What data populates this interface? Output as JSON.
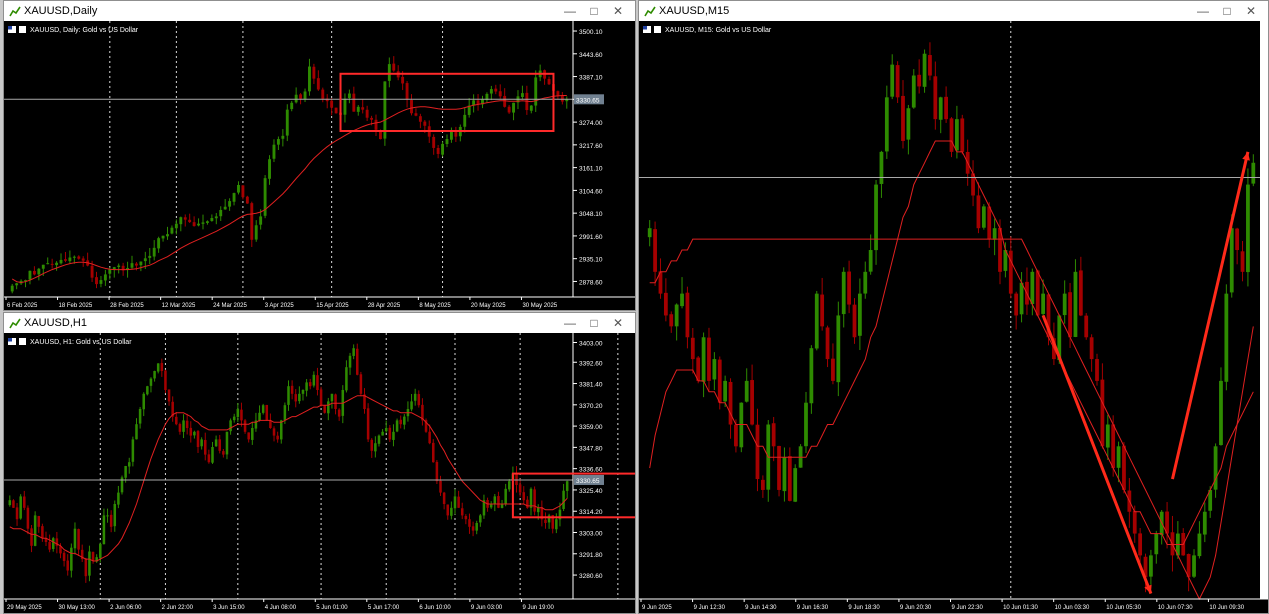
{
  "colors": {
    "bg": "#000000",
    "grid": "#ffffff",
    "axis": "#ffffff",
    "text": "#ffffff",
    "bull": "#2e8b00",
    "bear": "#a50000",
    "ma": "#e02020",
    "box": "#ff2a2a",
    "arrow": "#ff2a1a",
    "priceLine": "#a9a9a9",
    "priceTagBg": "#708090"
  },
  "windows": [
    {
      "id": "daily",
      "title": "XAUUSD,Daily",
      "icon": "chart-window-icon"
    },
    {
      "id": "h1",
      "title": "XAUUSD,H1",
      "icon": "chart-window-icon"
    },
    {
      "id": "m15",
      "title": "XAUUSD,M15",
      "icon": "chart-window-icon"
    }
  ],
  "chart_data": [
    {
      "type": "candlestick",
      "id": "daily",
      "symbol_line": "XAUUSD, Daily:  Gold vs US Dollar",
      "ylim": [
        2840,
        3525
      ],
      "yticks": [
        "3500.10",
        "3443.60",
        "3387.10",
        "3330.60",
        "3274.00",
        "3217.60",
        "3161.10",
        "3104.60",
        "3048.10",
        "2991.60",
        "2935.10",
        "2878.60"
      ],
      "xticks": [
        "6 Feb 2025",
        "18 Feb 2025",
        "28 Feb 2025",
        "12 Mar 2025",
        "24 Mar 2025",
        "3 Apr 2025",
        "15 Apr 2025",
        "28 Apr 2025",
        "8 May 2025",
        "20 May 2025",
        "30 May 2025"
      ],
      "current_price": "3330.65",
      "current_price_value": 3330.65,
      "vlines_at_candles": [
        22,
        37,
        52,
        72,
        97
      ],
      "closes": [
        2868,
        2874,
        2880,
        2882,
        2905,
        2896,
        2910,
        2920,
        2924,
        2920,
        2925,
        2932,
        2930,
        2938,
        2940,
        2935,
        2930,
        2918,
        2888,
        2872,
        2882,
        2896,
        2908,
        2914,
        2918,
        2906,
        2912,
        2924,
        2918,
        2928,
        2936,
        2942,
        2962,
        2986,
        2992,
        2996,
        3012,
        3022,
        3038,
        3032,
        3026,
        3016,
        3022,
        3025,
        3028,
        3036,
        3040,
        3056,
        3064,
        3078,
        3098,
        3118,
        3088,
        3072,
        2982,
        3018,
        3040,
        3135,
        3182,
        3218,
        3232,
        3240,
        3305,
        3322,
        3342,
        3332,
        3350,
        3412,
        3382,
        3355,
        3332,
        3326,
        3310,
        3296,
        3292,
        3332,
        3345,
        3300,
        3312,
        3305,
        3285,
        3280,
        3255,
        3232,
        3375,
        3418,
        3402,
        3385,
        3370,
        3330,
        3296,
        3290,
        3275,
        3265,
        3238,
        3210,
        3195,
        3220,
        3232,
        3250,
        3238,
        3262,
        3292,
        3315,
        3328,
        3318,
        3330,
        3344,
        3356,
        3350,
        3338,
        3312,
        3298,
        3322,
        3338,
        3346,
        3304,
        3315,
        3385,
        3402,
        3382,
        3368,
        3352,
        3340,
        3325,
        3330
      ],
      "ma": [
        2885,
        2878,
        2876,
        2878,
        2882,
        2887,
        2892,
        2898,
        2903,
        2908,
        2912,
        2916,
        2920,
        2923,
        2925,
        2926,
        2926,
        2925,
        2922,
        2918,
        2914,
        2911,
        2909,
        2908,
        2908,
        2908,
        2908,
        2909,
        2910,
        2913,
        2916,
        2919,
        2924,
        2930,
        2935,
        2940,
        2947,
        2954,
        2961,
        2967,
        2973,
        2978,
        2983,
        2988,
        2993,
        2998,
        3003,
        3009,
        3015,
        3021,
        3028,
        3035,
        3041,
        3045,
        3046,
        3048,
        3051,
        3057,
        3066,
        3076,
        3086,
        3096,
        3108,
        3121,
        3134,
        3146,
        3158,
        3172,
        3184,
        3194,
        3204,
        3213,
        3221,
        3228,
        3234,
        3241,
        3247,
        3253,
        3258,
        3263,
        3267,
        3270,
        3272,
        3274,
        3279,
        3285,
        3291,
        3297,
        3302,
        3306,
        3309,
        3311,
        3312,
        3312,
        3311,
        3309,
        3307,
        3306,
        3306,
        3306,
        3306,
        3307,
        3310,
        3313,
        3316,
        3318,
        3320,
        3322,
        3324,
        3326,
        3327,
        3327,
        3326,
        3326,
        3326,
        3327,
        3326,
        3325,
        3327,
        3331,
        3334,
        3336,
        3338,
        3339,
        3340,
        3340
      ],
      "box": {
        "t0": 74,
        "t1": 122,
        "high": 3394,
        "low": 3252
      }
    },
    {
      "type": "candlestick",
      "id": "h1",
      "symbol_line": "XAUUSD, H1:  Gold vs US Dollar",
      "ylim": [
        3268,
        3408
      ],
      "yticks": [
        "3403.00",
        "3392.60",
        "3381.40",
        "3370.20",
        "3359.00",
        "3347.80",
        "3336.60",
        "3325.40",
        "3314.20",
        "3303.00",
        "3291.80",
        "3280.60"
      ],
      "xticks": [
        "29 May 2025",
        "30 May 13:00",
        "2 Jun 06:00",
        "2 Jun 22:00",
        "3 Jun 15:00",
        "4 Jun 08:00",
        "5 Jun 01:00",
        "5 Jun 17:00",
        "6 Jun 10:00",
        "9 Jun 03:00",
        "9 Jun 19:00"
      ],
      "current_price": "3330.65",
      "current_price_value": 3330.65,
      "vlines_at_candles": [
        25,
        43,
        63,
        86,
        104,
        123,
        141,
        168,
        179
      ],
      "closes": [
        3320,
        3316,
        3310,
        3322,
        3316,
        3305,
        3296,
        3312,
        3306,
        3300,
        3298,
        3294,
        3300,
        3296,
        3292,
        3288,
        3283,
        3295,
        3305,
        3294,
        3289,
        3280,
        3293,
        3288,
        3290,
        3297,
        3312,
        3312,
        3306,
        3318,
        3324,
        3332,
        3338,
        3340,
        3352,
        3360,
        3368,
        3376,
        3380,
        3384,
        3388,
        3392,
        3388,
        3378,
        3372,
        3364,
        3360,
        3356,
        3362,
        3358,
        3354,
        3356,
        3348,
        3352,
        3344,
        3340,
        3348,
        3352,
        3346,
        3344,
        3356,
        3362,
        3364,
        3368,
        3362,
        3356,
        3352,
        3358,
        3362,
        3366,
        3370,
        3362,
        3358,
        3354,
        3352,
        3362,
        3370,
        3380,
        3376,
        3372,
        3376,
        3378,
        3382,
        3380,
        3386,
        3378,
        3370,
        3366,
        3372,
        3376,
        3368,
        3364,
        3378,
        3390,
        3396,
        3400,
        3386,
        3376,
        3368,
        3352,
        3346,
        3350,
        3354,
        3356,
        3358,
        3352,
        3356,
        3362,
        3360,
        3364,
        3368,
        3372,
        3376,
        3370,
        3362,
        3356,
        3350,
        3340,
        3330,
        3324,
        3318,
        3312,
        3316,
        3322,
        3316,
        3312,
        3310,
        3306,
        3304,
        3308,
        3312,
        3320,
        3316,
        3318,
        3322,
        3316,
        3318,
        3326,
        3330,
        3334,
        3328,
        3324,
        3320,
        3316,
        3326,
        3314,
        3316,
        3310,
        3308,
        3312,
        3305,
        3310,
        3315,
        3325,
        3330
      ],
      "ma": [
        3306,
        3305,
        3305,
        3305,
        3304,
        3303,
        3302,
        3302,
        3301,
        3300,
        3300,
        3299,
        3298,
        3297,
        3296,
        3294,
        3293,
        3292,
        3292,
        3291,
        3290,
        3289,
        3289,
        3288,
        3288,
        3289,
        3290,
        3291,
        3293,
        3295,
        3297,
        3300,
        3304,
        3308,
        3313,
        3318,
        3324,
        3330,
        3336,
        3342,
        3347,
        3352,
        3356,
        3360,
        3363,
        3365,
        3366,
        3366,
        3366,
        3365,
        3364,
        3362,
        3361,
        3359,
        3358,
        3357,
        3357,
        3357,
        3357,
        3357,
        3357,
        3358,
        3359,
        3360,
        3360,
        3360,
        3360,
        3361,
        3361,
        3362,
        3362,
        3362,
        3362,
        3361,
        3361,
        3361,
        3362,
        3363,
        3364,
        3364,
        3365,
        3366,
        3367,
        3368,
        3369,
        3369,
        3370,
        3370,
        3370,
        3371,
        3371,
        3371,
        3371,
        3372,
        3373,
        3374,
        3375,
        3375,
        3375,
        3374,
        3373,
        3372,
        3371,
        3370,
        3369,
        3368,
        3367,
        3367,
        3366,
        3366,
        3366,
        3366,
        3365,
        3364,
        3363,
        3361,
        3359,
        3356,
        3353,
        3349,
        3346,
        3342,
        3339,
        3336,
        3333,
        3330,
        3328,
        3326,
        3324,
        3322,
        3320,
        3319,
        3318,
        3318,
        3318,
        3318,
        3318,
        3318,
        3318,
        3318,
        3318,
        3318,
        3318,
        3317,
        3317,
        3317,
        3316,
        3316,
        3315,
        3315,
        3315,
        3316,
        3317,
        3319,
        3321
      ],
      "box": {
        "t0": 139,
        "t1": 179,
        "high": 3334,
        "low": 3311
      }
    },
    {
      "type": "candlestick",
      "id": "m15",
      "symbol_line": "XAUUSD, M15:  Gold vs US Dollar",
      "ylim": [
        3292,
        3345
      ],
      "yticks": [],
      "xticks": [
        "9 Jun 2025",
        "9 Jun 12:30",
        "9 Jun 14:30",
        "9 Jun 16:30",
        "9 Jun 18:30",
        "9 Jun 20:30",
        "9 Jun 22:30",
        "10 Jun 01:30",
        "10 Jun 03:30",
        "10 Jun 05:30",
        "10 Jun 07:30",
        "10 Jun 09:30"
      ],
      "current_price": "",
      "current_price_value": 3330.65,
      "vlines_at_candles": [
        67
      ],
      "closes": [
        3326,
        3322,
        3320,
        3318,
        3317,
        3319,
        3320,
        3316,
        3314,
        3312,
        3316,
        3312,
        3314,
        3310,
        3312,
        3308,
        3306,
        3310,
        3312,
        3308,
        3303,
        3302,
        3308,
        3306,
        3302,
        3305,
        3301,
        3304,
        3306,
        3310,
        3315,
        3320,
        3317,
        3314,
        3312,
        3318,
        3322,
        3319,
        3316,
        3320,
        3322,
        3324,
        3330,
        3333,
        3338,
        3341,
        3338,
        3334,
        3337,
        3340,
        3339,
        3342,
        3340,
        3336,
        3338,
        3336,
        3333,
        3336,
        3333,
        3331,
        3329,
        3326,
        3328,
        3325,
        3326,
        3322,
        3324,
        3320,
        3318,
        3321,
        3319,
        3322,
        3318,
        3320,
        3316,
        3314,
        3318,
        3320,
        3316,
        3322,
        3318,
        3316,
        3314,
        3312,
        3306,
        3308,
        3304,
        3306,
        3302,
        3300,
        3298,
        3296,
        3294,
        3296,
        3298,
        3300,
        3298,
        3296,
        3298,
        3296,
        3294,
        3296,
        3298,
        3300,
        3302,
        3306,
        3312,
        3320,
        3326,
        3324,
        3322,
        3330,
        3332
      ],
      "ma": [
        3304,
        3307,
        3309,
        3311,
        3312,
        3313,
        3313,
        3313,
        3313,
        3312,
        3312,
        3311,
        3311,
        3310,
        3310,
        3309,
        3308,
        3308,
        3308,
        3307,
        3306,
        3306,
        3305,
        3305,
        3305,
        3305,
        3305,
        3305,
        3305,
        3305,
        3306,
        3306,
        3307,
        3308,
        3308,
        3309,
        3310,
        3311,
        3312,
        3313,
        3314,
        3316,
        3317,
        3319,
        3321,
        3323,
        3325,
        3327,
        3328,
        3330,
        3331,
        3332,
        3333,
        3334,
        3334,
        3334,
        3334,
        3333,
        3333,
        3332,
        3331,
        3330,
        3329,
        3328,
        3327,
        3326,
        3324,
        3323,
        3322,
        3321,
        3320,
        3319,
        3318,
        3317,
        3316,
        3315,
        3314,
        3313,
        3312,
        3311,
        3310,
        3309,
        3308,
        3307,
        3306,
        3305,
        3304,
        3303,
        3302,
        3301,
        3300,
        3300,
        3299,
        3298,
        3298,
        3298,
        3297,
        3297,
        3297,
        3297,
        3298,
        3299,
        3300,
        3301,
        3302,
        3303,
        3304,
        3306,
        3307,
        3308,
        3309,
        3310,
        3311
      ],
      "ma2": [
        3321,
        3321,
        3322,
        3322,
        3323,
        3323,
        3324,
        3324,
        3325,
        3325,
        3325,
        3325,
        3325,
        3325,
        3325,
        3325,
        3325,
        3325,
        3325,
        3325,
        3325,
        3325,
        3325,
        3325,
        3325,
        3325,
        3325,
        3325,
        3325,
        3325,
        3325,
        3325,
        3325,
        3325,
        3325,
        3325,
        3325,
        3325,
        3325,
        3325,
        3325,
        3325,
        3325,
        3325,
        3325,
        3325,
        3325,
        3325,
        3325,
        3325,
        3325,
        3325,
        3325,
        3325,
        3325,
        3325,
        3325,
        3325,
        3325,
        3325,
        3325,
        3325,
        3325,
        3325,
        3325,
        3325,
        3325,
        3325,
        3325,
        3325,
        3324,
        3323,
        3322,
        3321,
        3320,
        3319,
        3318,
        3317,
        3316,
        3315,
        3314,
        3313,
        3312,
        3311,
        3310,
        3309,
        3308,
        3307,
        3306,
        3305,
        3304,
        3303,
        3302,
        3301,
        3300,
        3299,
        3298,
        3297,
        3296,
        3295,
        3294,
        3293,
        3292,
        3293,
        3294,
        3296,
        3299,
        3302,
        3305,
        3308,
        3311,
        3314,
        3317
      ],
      "arrows": [
        {
          "from": [
            73,
            3318
          ],
          "to": [
            93,
            3292.5
          ]
        },
        {
          "from": [
            97,
            3303
          ],
          "to": [
            111,
            3333
          ]
        }
      ]
    }
  ]
}
